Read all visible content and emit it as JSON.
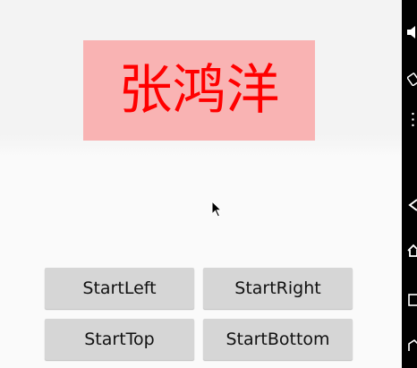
{
  "title_box": {
    "name": "张鸿洋",
    "text_color": "#ff0000",
    "background_color": "#f9b3b3"
  },
  "buttons": {
    "start_left": "StartLeft",
    "start_right": "StartRight",
    "start_top": "StartTop",
    "start_bottom": "StartBottom"
  },
  "nav_bar": {
    "icons": [
      "volume-icon",
      "rotate-icon",
      "menu-dots-icon",
      "back-icon",
      "home-icon",
      "recents-icon"
    ]
  }
}
